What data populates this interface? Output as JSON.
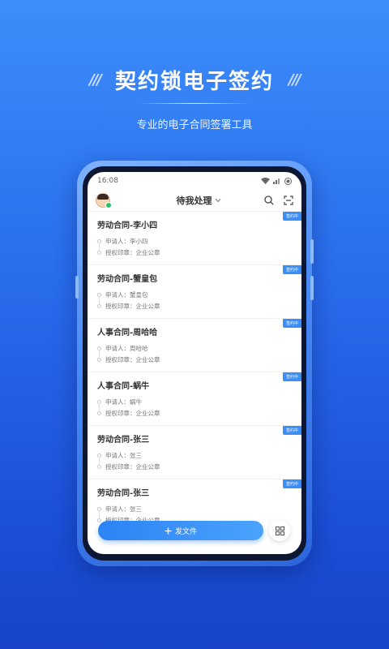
{
  "hero": {
    "slashes_left": "///",
    "title": "契约锁电子签约",
    "slashes_right": "///",
    "subtitle": "专业的电子合同签署工具"
  },
  "status_bar": {
    "time": "16:08"
  },
  "header": {
    "title": "待我处理"
  },
  "list": [
    {
      "badge": "签约中",
      "title": "劳动合同-李小四",
      "applicant_label": "申请人：",
      "applicant": "李小四",
      "seal_label": "授权印章：",
      "seal": "企业公章"
    },
    {
      "badge": "签约中",
      "title": "劳动合同-蟹皇包",
      "applicant_label": "申请人：",
      "applicant": "蟹皇包",
      "seal_label": "授权印章：",
      "seal": "企业公章"
    },
    {
      "badge": "签约中",
      "title": "人事合同-周哈哈",
      "applicant_label": "申请人：",
      "applicant": "周哈哈",
      "seal_label": "授权印章：",
      "seal": "企业公章"
    },
    {
      "badge": "签约中",
      "title": "人事合同-蜗牛",
      "applicant_label": "申请人：",
      "applicant": "蜗牛",
      "seal_label": "授权印章：",
      "seal": "企业公章"
    },
    {
      "badge": "签约中",
      "title": "劳动合同-张三",
      "applicant_label": "申请人：",
      "applicant": "张三",
      "seal_label": "授权印章：",
      "seal": "企业公章"
    },
    {
      "badge": "签约中",
      "title": "劳动合同-张三",
      "applicant_label": "申请人：",
      "applicant": "张三",
      "seal_label": "授权印章：",
      "seal": "企业公章"
    }
  ],
  "bottom": {
    "send_label": "发文件"
  },
  "colors": {
    "accent": "#3a8ef7",
    "background_top": "#3d8dfb",
    "background_bottom": "#1744c8"
  }
}
